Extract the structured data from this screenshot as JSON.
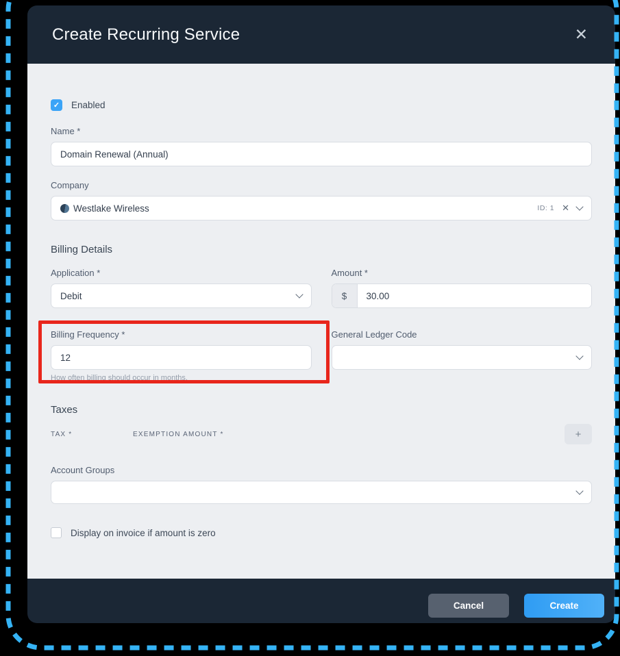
{
  "modal": {
    "title": "Create Recurring Service"
  },
  "icons": {
    "close": "✕",
    "clear": "✕",
    "check": "✓",
    "plus": "+"
  },
  "form": {
    "enabled": {
      "label": "Enabled",
      "checked": true
    },
    "name": {
      "label": "Name *",
      "value": "Domain Renewal (Annual)"
    },
    "company": {
      "label": "Company",
      "value": "Westlake Wireless",
      "id_badge": "ID: 1"
    },
    "billing_details_heading": "Billing Details",
    "application": {
      "label": "Application *",
      "value": "Debit"
    },
    "amount": {
      "label": "Amount *",
      "prefix": "$",
      "value": "30.00"
    },
    "billing_frequency": {
      "label": "Billing Frequency *",
      "value": "12",
      "helper": "How often billing should occur in months."
    },
    "general_ledger_code": {
      "label": "General Ledger Code",
      "value": ""
    },
    "taxes_heading": "Taxes",
    "tax_column": "TAX *",
    "exemption_column": "EXEMPTION AMOUNT *",
    "account_groups": {
      "label": "Account Groups",
      "value": ""
    },
    "display_zero": {
      "label": "Display on invoice if amount is zero",
      "checked": false
    }
  },
  "footer": {
    "cancel_label": "Cancel",
    "create_label": "Create"
  },
  "colors": {
    "header_navy": "#1b2735",
    "body_gray": "#edeff2",
    "accent_blue": "#3ba4f7",
    "create_gradient_start": "#2f9cf3",
    "create_gradient_end": "#50b1f8",
    "cancel_gray": "#57616f",
    "highlight_red": "#e8261c",
    "selection_dash_blue": "#35b3f5"
  }
}
